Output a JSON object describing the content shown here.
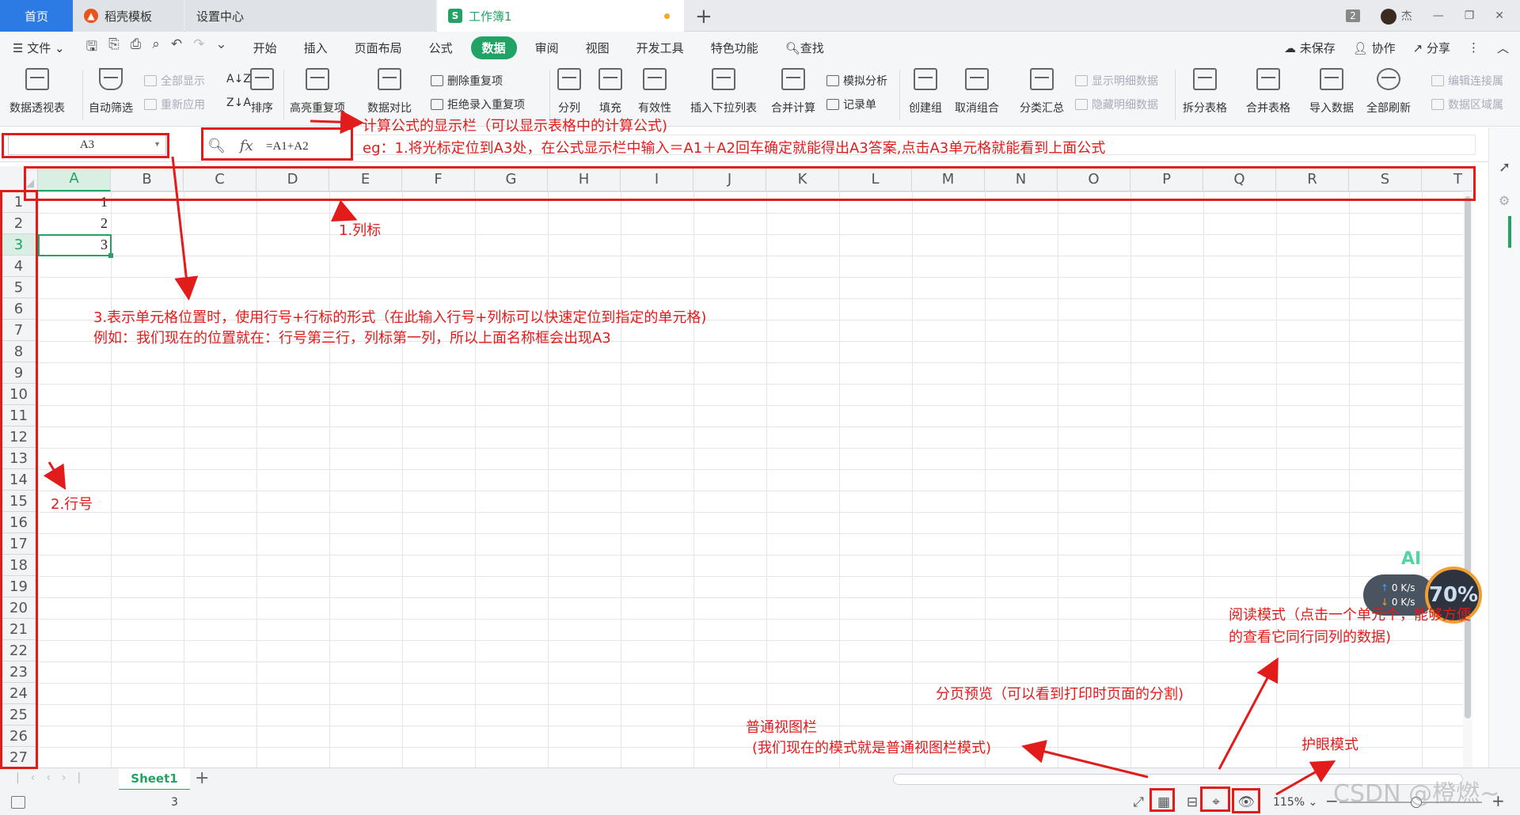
{
  "tabs": {
    "home": "首页",
    "templates": "稻壳模板",
    "settings": "设置中心",
    "workbook": "工作簿1",
    "workbook_badge": "S"
  },
  "titlebar": {
    "count_badge": "2",
    "user": "杰"
  },
  "menu": {
    "file": "文件",
    "items": [
      "开始",
      "插入",
      "页面布局",
      "公式",
      "数据",
      "审阅",
      "视图",
      "开发工具",
      "特色功能"
    ],
    "active": "数据",
    "search": "查找",
    "unsaved": "未保存",
    "collab": "协作",
    "share": "分享"
  },
  "ribbon": {
    "pivot": "数据透视表",
    "autofilter": "自动筛选",
    "show_all": "全部显示",
    "reapply": "重新应用",
    "sort": "排序",
    "highlight_dup": "高亮重复项",
    "compare": "数据对比",
    "remove_dup": "删除重复项",
    "reject_dup": "拒绝录入重复项",
    "split_col": "分列",
    "fill": "填充",
    "validity": "有效性",
    "dropdown": "插入下拉列表",
    "consolidate": "合并计算",
    "simulate": "模拟分析",
    "record": "记录单",
    "group": "创建组",
    "ungroup": "取消组合",
    "subtotal": "分类汇总",
    "show_detail": "显示明细数据",
    "hide_detail": "隐藏明细数据",
    "split_table": "拆分表格",
    "merge_table": "合并表格",
    "import": "导入数据",
    "refresh_all": "全部刷新",
    "edit_links": "编辑连接属",
    "data_area": "数据区域属"
  },
  "formula_bar": {
    "name_box": "A3",
    "fx_label": "fx",
    "formula": "=A1+A2"
  },
  "grid": {
    "columns": [
      "A",
      "B",
      "C",
      "D",
      "E",
      "F",
      "G",
      "H",
      "I",
      "J",
      "K",
      "L",
      "M",
      "N",
      "O",
      "P",
      "Q",
      "R",
      "S",
      "T"
    ],
    "rows": [
      "1",
      "2",
      "3",
      "4",
      "5",
      "6",
      "7",
      "8",
      "9",
      "10",
      "11",
      "12",
      "13",
      "14",
      "15",
      "16",
      "17",
      "18",
      "19",
      "20",
      "21",
      "22",
      "23",
      "24",
      "25",
      "26",
      "27"
    ],
    "cells": {
      "A1": "1",
      "A2": "2",
      "A3": "3"
    },
    "selected_cell": "A3"
  },
  "sheets": {
    "active": "Sheet1"
  },
  "status": {
    "count": "3",
    "zoom": "115%"
  },
  "widget": {
    "ai": "AI",
    "up": "0 K/s",
    "down": "0 K/s",
    "percent": "70%"
  },
  "watermark": "CSDN @橙燃~",
  "annotations": {
    "formula_title": "计算公式的显示栏（可以显示表格中的计算公式)",
    "formula_example": "eg：1.将光标定位到A3处，在公式显示栏中输入＝A1＋A2回车确定就能得出A3答案,点击A3单元格就能看到上面公式",
    "col_label": "1.列标",
    "row_label": "2.行号",
    "cell_pos_1": "3.表示单元格位置时，使用行号+行标的形式（在此输入行号+列标可以快速定位到指定的单元格)",
    "cell_pos_2": "例如：我们现在的位置就在：行号第三行，列标第一列，所以上面名称框会出现A3",
    "reading_1": "阅读模式（点击一个单元个，能够方便",
    "reading_2": "的查看它同行同列的数据)",
    "page_preview": "分页预览（可以看到打印时页面的分割)",
    "normal_1": "普通视图栏",
    "normal_2": "(我们现在的模式就是普通视图栏模式)",
    "eye": "护眼模式"
  }
}
